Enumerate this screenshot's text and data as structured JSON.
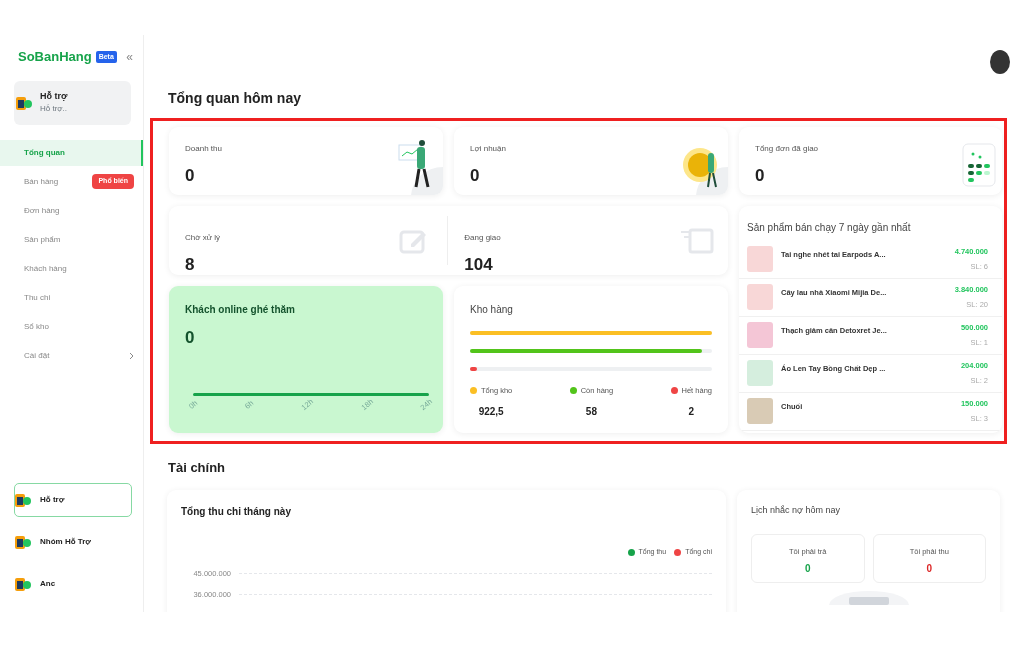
{
  "sidebar": {
    "logo": "SoBanHang",
    "logo_badge": "Beta",
    "collapse_icon": "«",
    "account": {
      "name": "Hỗ trợ",
      "subtitle": "Hỗ trợ.."
    },
    "nav": [
      {
        "label": "Tổng quan",
        "selected": true
      },
      {
        "label": "Bán hàng",
        "selected": false,
        "badge": "Phổ biến"
      },
      {
        "label": "Đơn hàng",
        "selected": false
      },
      {
        "label": "Sản phẩm",
        "selected": false
      },
      {
        "label": "Khách hàng",
        "selected": false
      },
      {
        "label": "Thu chi",
        "selected": false
      },
      {
        "label": "Sổ kho",
        "selected": false
      },
      {
        "label": "Cài đặt",
        "selected": false,
        "expandable": true
      }
    ],
    "shops": [
      {
        "name": "Hỗ trợ",
        "selected": true
      },
      {
        "name": "Nhóm Hỗ Trợ",
        "selected": false
      },
      {
        "name": "Anc",
        "selected": false
      }
    ]
  },
  "overview": {
    "title": "Tổng quan hôm nay",
    "highlighted": true,
    "stats": [
      {
        "label": "Doanh thu",
        "value": "0",
        "kind": "chart"
      },
      {
        "label": "Lợi nhuận",
        "value": "0",
        "kind": "coin"
      },
      {
        "label": "Tổng đơn đã giao",
        "value": "0",
        "kind": "calendar"
      }
    ],
    "orders": [
      {
        "label": "Chờ xử lý",
        "value": "8",
        "kind": "edit"
      },
      {
        "label": "Đang giao",
        "value": "104",
        "kind": "box"
      }
    ],
    "online": {
      "title": "Khách online ghé thăm",
      "value": "0",
      "x_labels": [
        "0h",
        "6h",
        "12h",
        "18h",
        "24h"
      ]
    },
    "stock": {
      "title": "Kho hàng",
      "items": [
        {
          "label": "Tổng kho",
          "value": "922,5",
          "level": 1,
          "color": "#fbbf24"
        },
        {
          "label": "Còn hàng",
          "value": "58",
          "level": 0.96,
          "color": "#52c41a"
        },
        {
          "label": "Hết hàng",
          "value": "2",
          "level": 0.03,
          "color": "#ef4444"
        }
      ]
    },
    "best_sellers": {
      "title": "Sản phẩm bán chạy 7 ngày gần nhất",
      "items": [
        {
          "name": "Tai nghe nhét tai Earpods A...",
          "amount": "4.740.000",
          "quantity": "SL: 6"
        },
        {
          "name": "Cây lau nhà Xiaomi Mijia De...",
          "amount": "3.840.000",
          "quantity": "SL: 20"
        },
        {
          "name": "Thạch giảm cân Detoxret Je...",
          "amount": "500.000",
          "quantity": "SL: 1"
        },
        {
          "name": "Áo Len Tay Bồng Chất Dẹp ...",
          "amount": "204.000",
          "quantity": "SL: 2"
        },
        {
          "name": "Chuối",
          "amount": "150.000",
          "quantity": "SL: 3"
        }
      ]
    }
  },
  "finance": {
    "title": "Tài chính",
    "cash_flow": {
      "title": "Tổng thu chi tháng này",
      "legend": [
        {
          "label": "Tổng thu",
          "color": "#16a34a"
        },
        {
          "label": "Tổng chi",
          "color": "#ef4444"
        }
      ],
      "y_labels": [
        "45.000.000",
        "36.000.000"
      ]
    },
    "debts": {
      "title": "Lịch nhắc nợ hôm nay",
      "items": [
        {
          "label": "Tôi phải trả",
          "value": "0",
          "color": "#16a34a"
        },
        {
          "label": "Tôi phải thu",
          "value": "0",
          "color": "#dc2626"
        }
      ]
    }
  }
}
